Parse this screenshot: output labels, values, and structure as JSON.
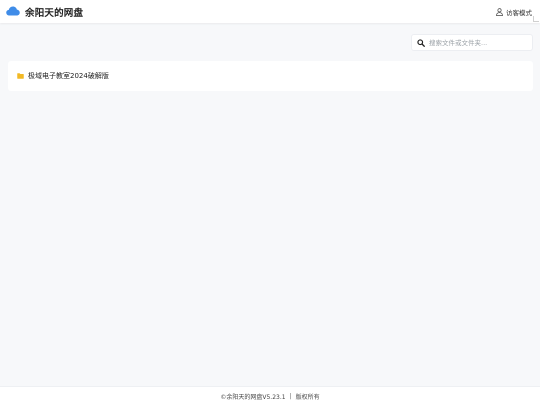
{
  "header": {
    "app_title": "余阳天的网盘",
    "guest_mode_label": "访客模式",
    "brand_color": "#3f8ce8"
  },
  "search": {
    "placeholder": "搜索文件或文件夹..."
  },
  "files": [
    {
      "name": "极域电子教室2024破解版",
      "type": "folder",
      "icon": "folder-icon",
      "icon_color": "#f2b925"
    }
  ],
  "footer": {
    "copyright": "©余阳天的网盘V5.23.1",
    "separator": "|",
    "rights": "版权所有"
  }
}
